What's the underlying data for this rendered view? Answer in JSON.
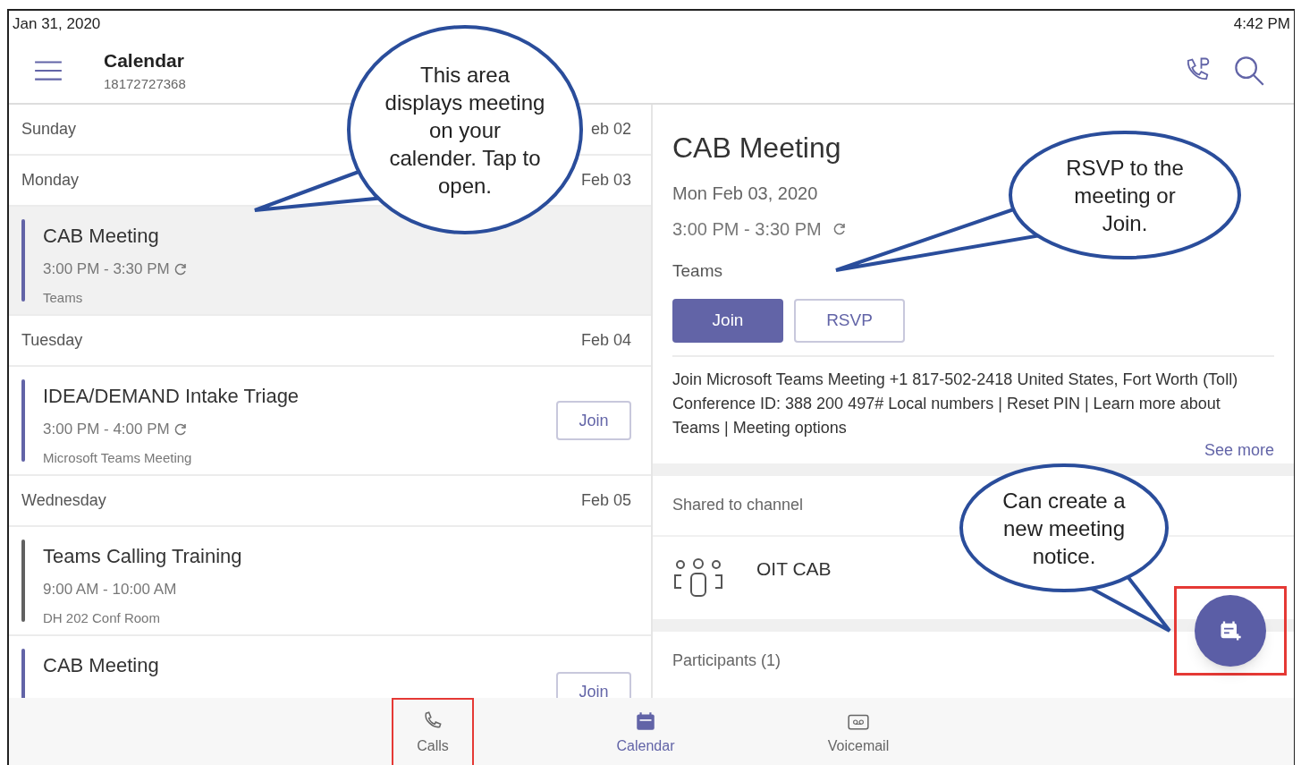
{
  "status_bar": {
    "date": "Jan 31, 2020",
    "time": "4:42 PM"
  },
  "header": {
    "title": "Calendar",
    "subtitle": "18172727368"
  },
  "agenda": [
    {
      "kind": "day",
      "label": "Sunday",
      "date": "eb 02"
    },
    {
      "kind": "day",
      "label": "Monday",
      "date": "Feb 03"
    },
    {
      "kind": "event",
      "title": "CAB Meeting",
      "time": "3:00 PM - 3:30 PM",
      "recurring": true,
      "location": "Teams",
      "selected": true,
      "color": "#6264a7"
    },
    {
      "kind": "day",
      "label": "Tuesday",
      "date": "Feb 04"
    },
    {
      "kind": "event",
      "title": "IDEA/DEMAND Intake Triage",
      "time": "3:00 PM - 4:00 PM",
      "recurring": true,
      "location": "Microsoft Teams Meeting",
      "selected": false,
      "color": "#6264a7",
      "button": "Join"
    },
    {
      "kind": "day",
      "label": "Wednesday",
      "date": "Feb 05"
    },
    {
      "kind": "event",
      "title": "Teams Calling Training",
      "time": "9:00 AM - 10:00 AM",
      "recurring": false,
      "location": "DH 202 Conf Room",
      "selected": false,
      "color": "#616161"
    },
    {
      "kind": "event",
      "title": "CAB Meeting",
      "selected": false,
      "color": "#6264a7",
      "button": "Join"
    }
  ],
  "details": {
    "title": "CAB Meeting",
    "date": "Mon Feb 03, 2020",
    "time": "3:00 PM - 3:30 PM",
    "recurring": true,
    "location": "Teams",
    "buttons": [
      {
        "label": "Join",
        "kind": "primary"
      },
      {
        "label": "RSVP",
        "kind": "outline"
      }
    ],
    "description": "Join Microsoft Teams Meeting +1 817-502-2418 United States, Fort Worth (Toll) Conference ID: 388 200 497# Local numbers | Reset PIN | Learn more about Teams | Meeting options",
    "see_more": "See more",
    "shared_label": "Shared to channel",
    "channel": "OIT CAB",
    "participants": "Participants (1)"
  },
  "fab": {
    "highlighted": true
  },
  "nav": [
    {
      "label": "Calls",
      "selected": false,
      "highlighted": true
    },
    {
      "label": "Calendar",
      "selected": true,
      "highlighted": false
    },
    {
      "label": "Voicemail",
      "selected": false,
      "highlighted": false
    }
  ],
  "callouts": [
    {
      "text": "This area displays meeting on your calender. Tap to open."
    },
    {
      "text": "RSVP to the meeting or Join."
    },
    {
      "text": "Can create a new meeting notice."
    }
  ]
}
